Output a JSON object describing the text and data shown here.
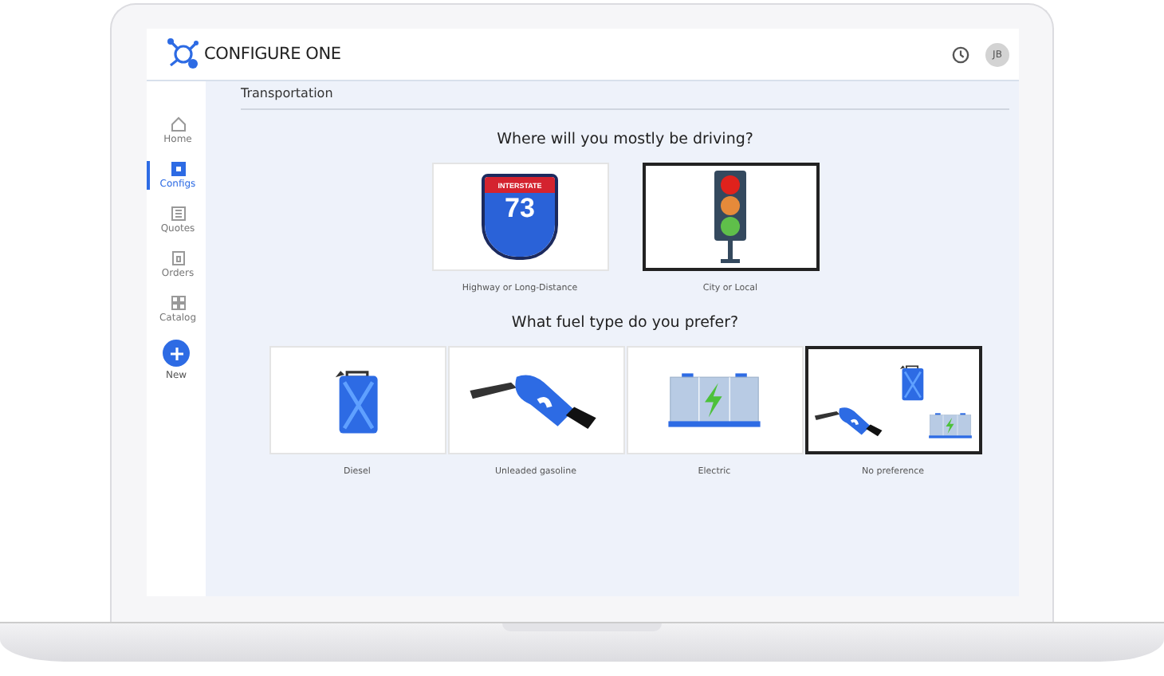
{
  "app": {
    "brand": "CONFIGURE ONE",
    "avatar": "JB"
  },
  "sidebar": {
    "items": [
      {
        "label": "Home",
        "kind": "home",
        "selected": false
      },
      {
        "label": "Configs",
        "kind": "configs",
        "selected": true
      },
      {
        "label": "Quotes",
        "kind": "quotes",
        "selected": false
      },
      {
        "label": "Orders",
        "kind": "orders",
        "selected": false
      },
      {
        "label": "Catalog",
        "kind": "catalog",
        "selected": false
      }
    ],
    "new_label": "New"
  },
  "breadcrumb": "Transportation",
  "questions": [
    {
      "title": "Where will you mostly be driving?",
      "options": [
        {
          "label": "Highway or Long-Distance",
          "kind": "interstate",
          "sign_text": "INTERSTATE",
          "sign_number": "73",
          "selected": false
        },
        {
          "label": "City or Local",
          "kind": "signal",
          "selected": true
        }
      ]
    },
    {
      "title": "What fuel type do you prefer?",
      "options": [
        {
          "label": "Diesel",
          "kind": "jerrycan",
          "selected": false
        },
        {
          "label": "Unleaded gasoline",
          "kind": "nozzle",
          "selected": false
        },
        {
          "label": "Electric",
          "kind": "battery",
          "selected": false
        },
        {
          "label": "No preference",
          "kind": "mixed",
          "selected": true
        }
      ]
    }
  ]
}
